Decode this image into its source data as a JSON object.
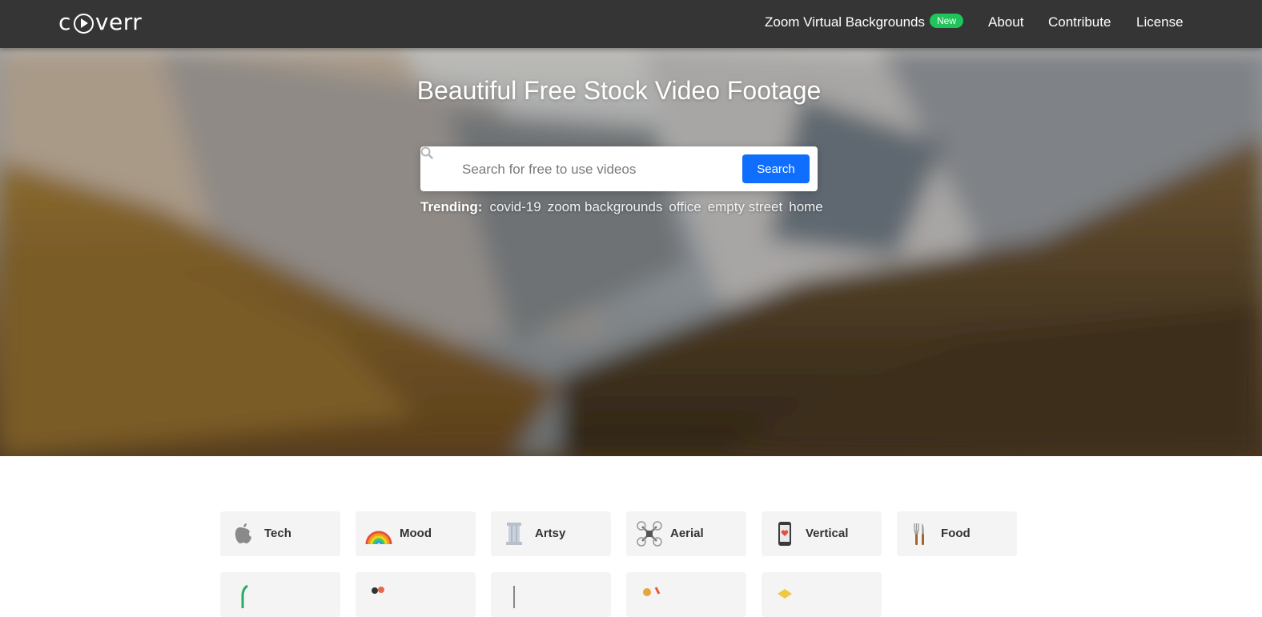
{
  "brand": {
    "logo_text": "coverr"
  },
  "nav": {
    "links": [
      {
        "label": "Zoom Virtual Backgrounds",
        "badge": "New"
      },
      {
        "label": "About"
      },
      {
        "label": "Contribute"
      },
      {
        "label": "License"
      }
    ]
  },
  "hero": {
    "title": "Beautiful Free Stock Video Footage",
    "search": {
      "placeholder": "Search for free to use videos",
      "button_label": "Search"
    },
    "trending": {
      "label": "Trending:",
      "tags": [
        "covid-19",
        "zoom backgrounds",
        "office",
        "empty street",
        "home"
      ]
    }
  },
  "categories": {
    "row1": [
      {
        "label": "Tech",
        "icon": "apple-icon"
      },
      {
        "label": "Mood",
        "icon": "rainbow-icon"
      },
      {
        "label": "Artsy",
        "icon": "column-icon"
      },
      {
        "label": "Aerial",
        "icon": "drone-icon"
      },
      {
        "label": "Vertical",
        "icon": "phone-icon"
      },
      {
        "label": "Food",
        "icon": "fork-knife-icon"
      }
    ]
  },
  "colors": {
    "navbar": "#353535",
    "accent": "#0f6efd",
    "badge": "#1fc45a",
    "card": "#f4f4f4"
  }
}
